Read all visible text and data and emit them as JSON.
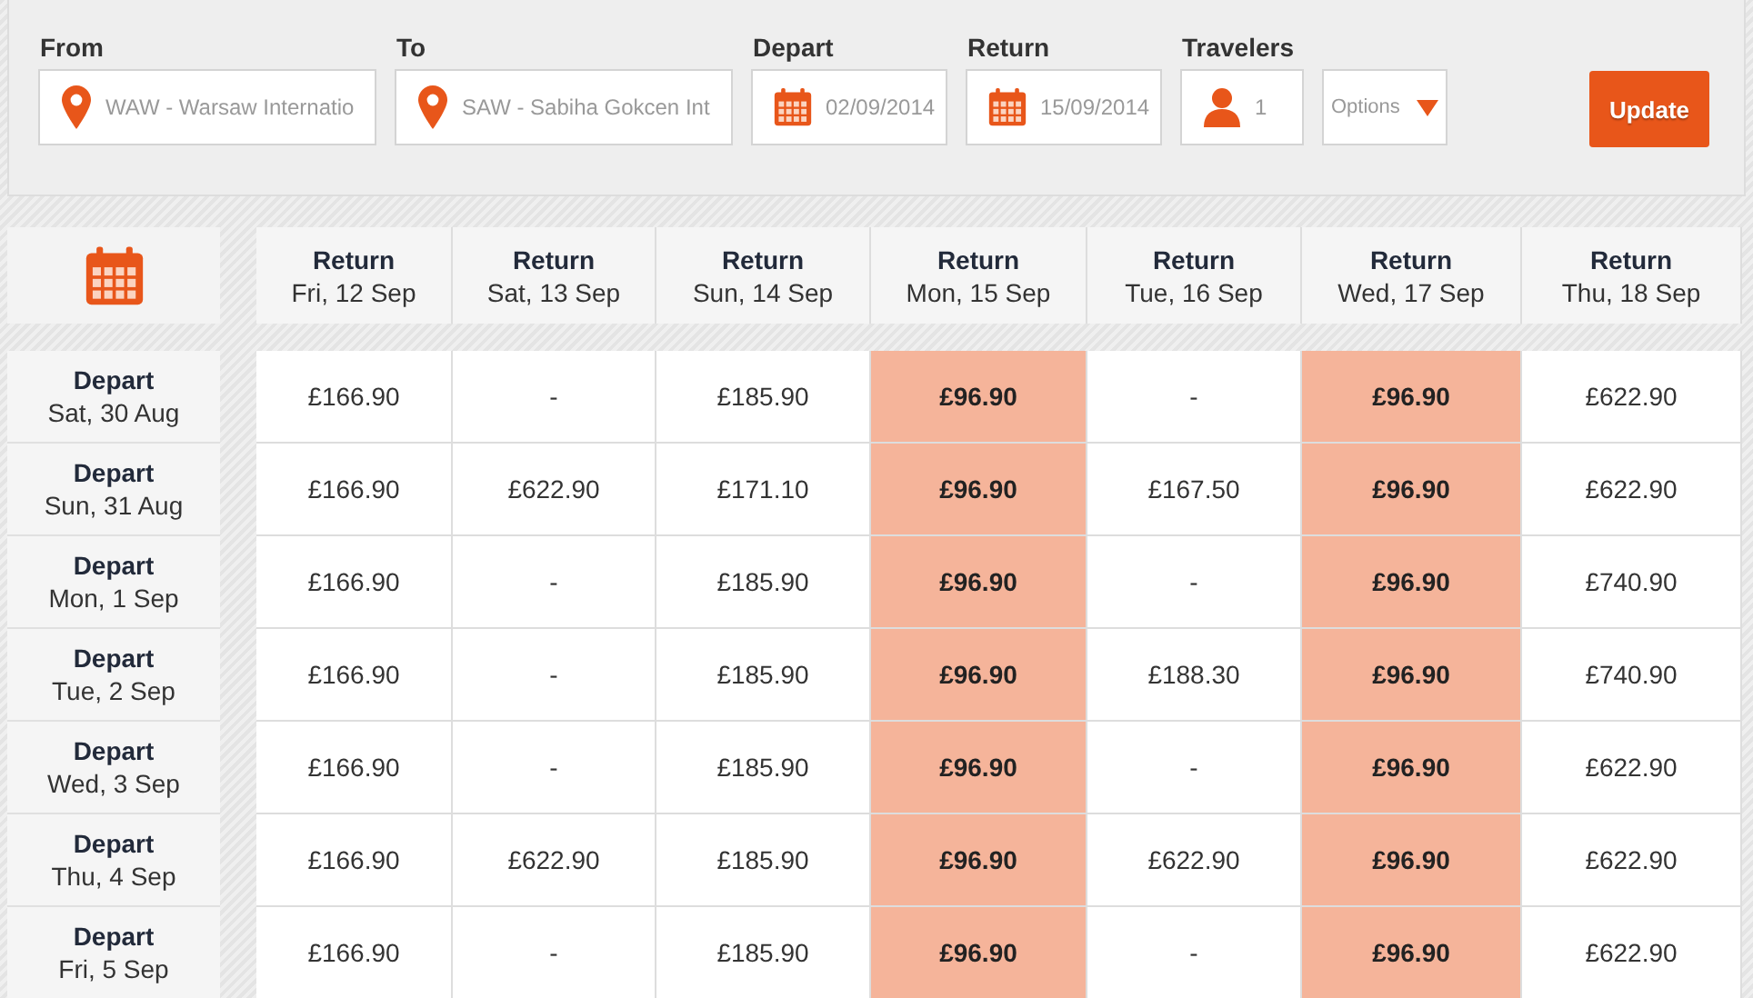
{
  "search": {
    "from": {
      "label": "From",
      "value": "WAW - Warsaw Internatio"
    },
    "to": {
      "label": "To",
      "value": "SAW - Sabiha Gokcen Int"
    },
    "depart": {
      "label": "Depart",
      "value": "02/09/2014"
    },
    "return": {
      "label": "Return",
      "value": "15/09/2014"
    },
    "travelers": {
      "label": "Travelers",
      "value": "1"
    },
    "options": {
      "placeholder": "Options"
    },
    "update_button": "Update"
  },
  "grid": {
    "columns": [
      {
        "title": "Return",
        "date": "Fri, 12 Sep"
      },
      {
        "title": "Return",
        "date": "Sat, 13 Sep"
      },
      {
        "title": "Return",
        "date": "Sun, 14 Sep"
      },
      {
        "title": "Return",
        "date": "Mon, 15 Sep"
      },
      {
        "title": "Return",
        "date": "Tue, 16 Sep"
      },
      {
        "title": "Return",
        "date": "Wed, 17 Sep"
      },
      {
        "title": "Return",
        "date": "Thu, 18 Sep"
      }
    ],
    "rows": [
      {
        "title": "Depart",
        "date": "Sat, 30 Aug",
        "cells": [
          {
            "price": "£166.90",
            "cheapest": false
          },
          {
            "price": "-",
            "cheapest": false
          },
          {
            "price": "£185.90",
            "cheapest": false
          },
          {
            "price": "£96.90",
            "cheapest": true
          },
          {
            "price": "-",
            "cheapest": false
          },
          {
            "price": "£96.90",
            "cheapest": true
          },
          {
            "price": "£622.90",
            "cheapest": false
          }
        ]
      },
      {
        "title": "Depart",
        "date": "Sun, 31 Aug",
        "cells": [
          {
            "price": "£166.90",
            "cheapest": false
          },
          {
            "price": "£622.90",
            "cheapest": false
          },
          {
            "price": "£171.10",
            "cheapest": false
          },
          {
            "price": "£96.90",
            "cheapest": true
          },
          {
            "price": "£167.50",
            "cheapest": false
          },
          {
            "price": "£96.90",
            "cheapest": true
          },
          {
            "price": "£622.90",
            "cheapest": false
          }
        ]
      },
      {
        "title": "Depart",
        "date": "Mon, 1 Sep",
        "cells": [
          {
            "price": "£166.90",
            "cheapest": false
          },
          {
            "price": "-",
            "cheapest": false
          },
          {
            "price": "£185.90",
            "cheapest": false
          },
          {
            "price": "£96.90",
            "cheapest": true
          },
          {
            "price": "-",
            "cheapest": false
          },
          {
            "price": "£96.90",
            "cheapest": true
          },
          {
            "price": "£740.90",
            "cheapest": false
          }
        ]
      },
      {
        "title": "Depart",
        "date": "Tue, 2 Sep",
        "cells": [
          {
            "price": "£166.90",
            "cheapest": false
          },
          {
            "price": "-",
            "cheapest": false
          },
          {
            "price": "£185.90",
            "cheapest": false
          },
          {
            "price": "£96.90",
            "cheapest": true
          },
          {
            "price": "£188.30",
            "cheapest": false
          },
          {
            "price": "£96.90",
            "cheapest": true
          },
          {
            "price": "£740.90",
            "cheapest": false
          }
        ]
      },
      {
        "title": "Depart",
        "date": "Wed, 3 Sep",
        "cells": [
          {
            "price": "£166.90",
            "cheapest": false
          },
          {
            "price": "-",
            "cheapest": false
          },
          {
            "price": "£185.90",
            "cheapest": false
          },
          {
            "price": "£96.90",
            "cheapest": true
          },
          {
            "price": "-",
            "cheapest": false
          },
          {
            "price": "£96.90",
            "cheapest": true
          },
          {
            "price": "£622.90",
            "cheapest": false
          }
        ]
      },
      {
        "title": "Depart",
        "date": "Thu, 4 Sep",
        "cells": [
          {
            "price": "£166.90",
            "cheapest": false
          },
          {
            "price": "£622.90",
            "cheapest": false
          },
          {
            "price": "£185.90",
            "cheapest": false
          },
          {
            "price": "£96.90",
            "cheapest": true
          },
          {
            "price": "£622.90",
            "cheapest": false
          },
          {
            "price": "£96.90",
            "cheapest": true
          },
          {
            "price": "£622.90",
            "cheapest": false
          }
        ]
      },
      {
        "title": "Depart",
        "date": "Fri, 5 Sep",
        "cells": [
          {
            "price": "£166.90",
            "cheapest": false
          },
          {
            "price": "-",
            "cheapest": false
          },
          {
            "price": "£185.90",
            "cheapest": false
          },
          {
            "price": "£96.90",
            "cheapest": true
          },
          {
            "price": "-",
            "cheapest": false
          },
          {
            "price": "£96.90",
            "cheapest": true
          },
          {
            "price": "£622.90",
            "cheapest": false
          }
        ]
      }
    ]
  }
}
